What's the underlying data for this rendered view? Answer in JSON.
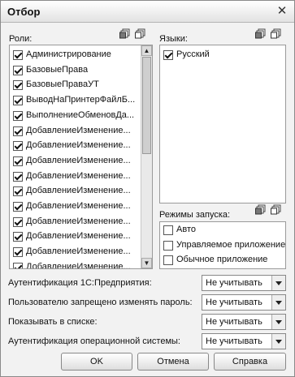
{
  "window": {
    "title": "Отбор",
    "close_glyph": "✕"
  },
  "roles": {
    "label": "Роли:",
    "items": [
      "Администрирование",
      "БазовыеПрава",
      "БазовыеПраваУТ",
      "ВыводНаПринтерФайлБ...",
      "ВыполнениеОбменовДа...",
      "ДобавлениеИзменение...",
      "ДобавлениеИзменение...",
      "ДобавлениеИзменение...",
      "ДобавлениеИзменение...",
      "ДобавлениеИзменение...",
      "ДобавлениеИзменение...",
      "ДобавлениеИзменение...",
      "ДобавлениеИзменение...",
      "ДобавлениеИзменение...",
      "ДобавлениеИзменение..."
    ],
    "checked": true
  },
  "languages": {
    "label": "Языки:",
    "items": [
      "Русский"
    ],
    "checked": true
  },
  "launch_modes": {
    "label": "Режимы запуска:",
    "items": [
      "Авто",
      "Управляемое приложение",
      "Обычное приложение"
    ],
    "checked": false
  },
  "filters": [
    {
      "label": "Аутентификация 1С:Предприятия:",
      "value": "Не учитывать"
    },
    {
      "label": "Пользователю запрещено изменять пароль:",
      "value": "Не учитывать"
    },
    {
      "label": "Показывать в списке:",
      "value": "Не учитывать"
    },
    {
      "label": "Аутентификация операционной системы:",
      "value": "Не учитывать"
    }
  ],
  "buttons": {
    "ok": "OK",
    "cancel": "Отмена",
    "help": "Справка"
  },
  "icons": [
    "check-all-icon",
    "uncheck-all-icon",
    "close-icon"
  ]
}
